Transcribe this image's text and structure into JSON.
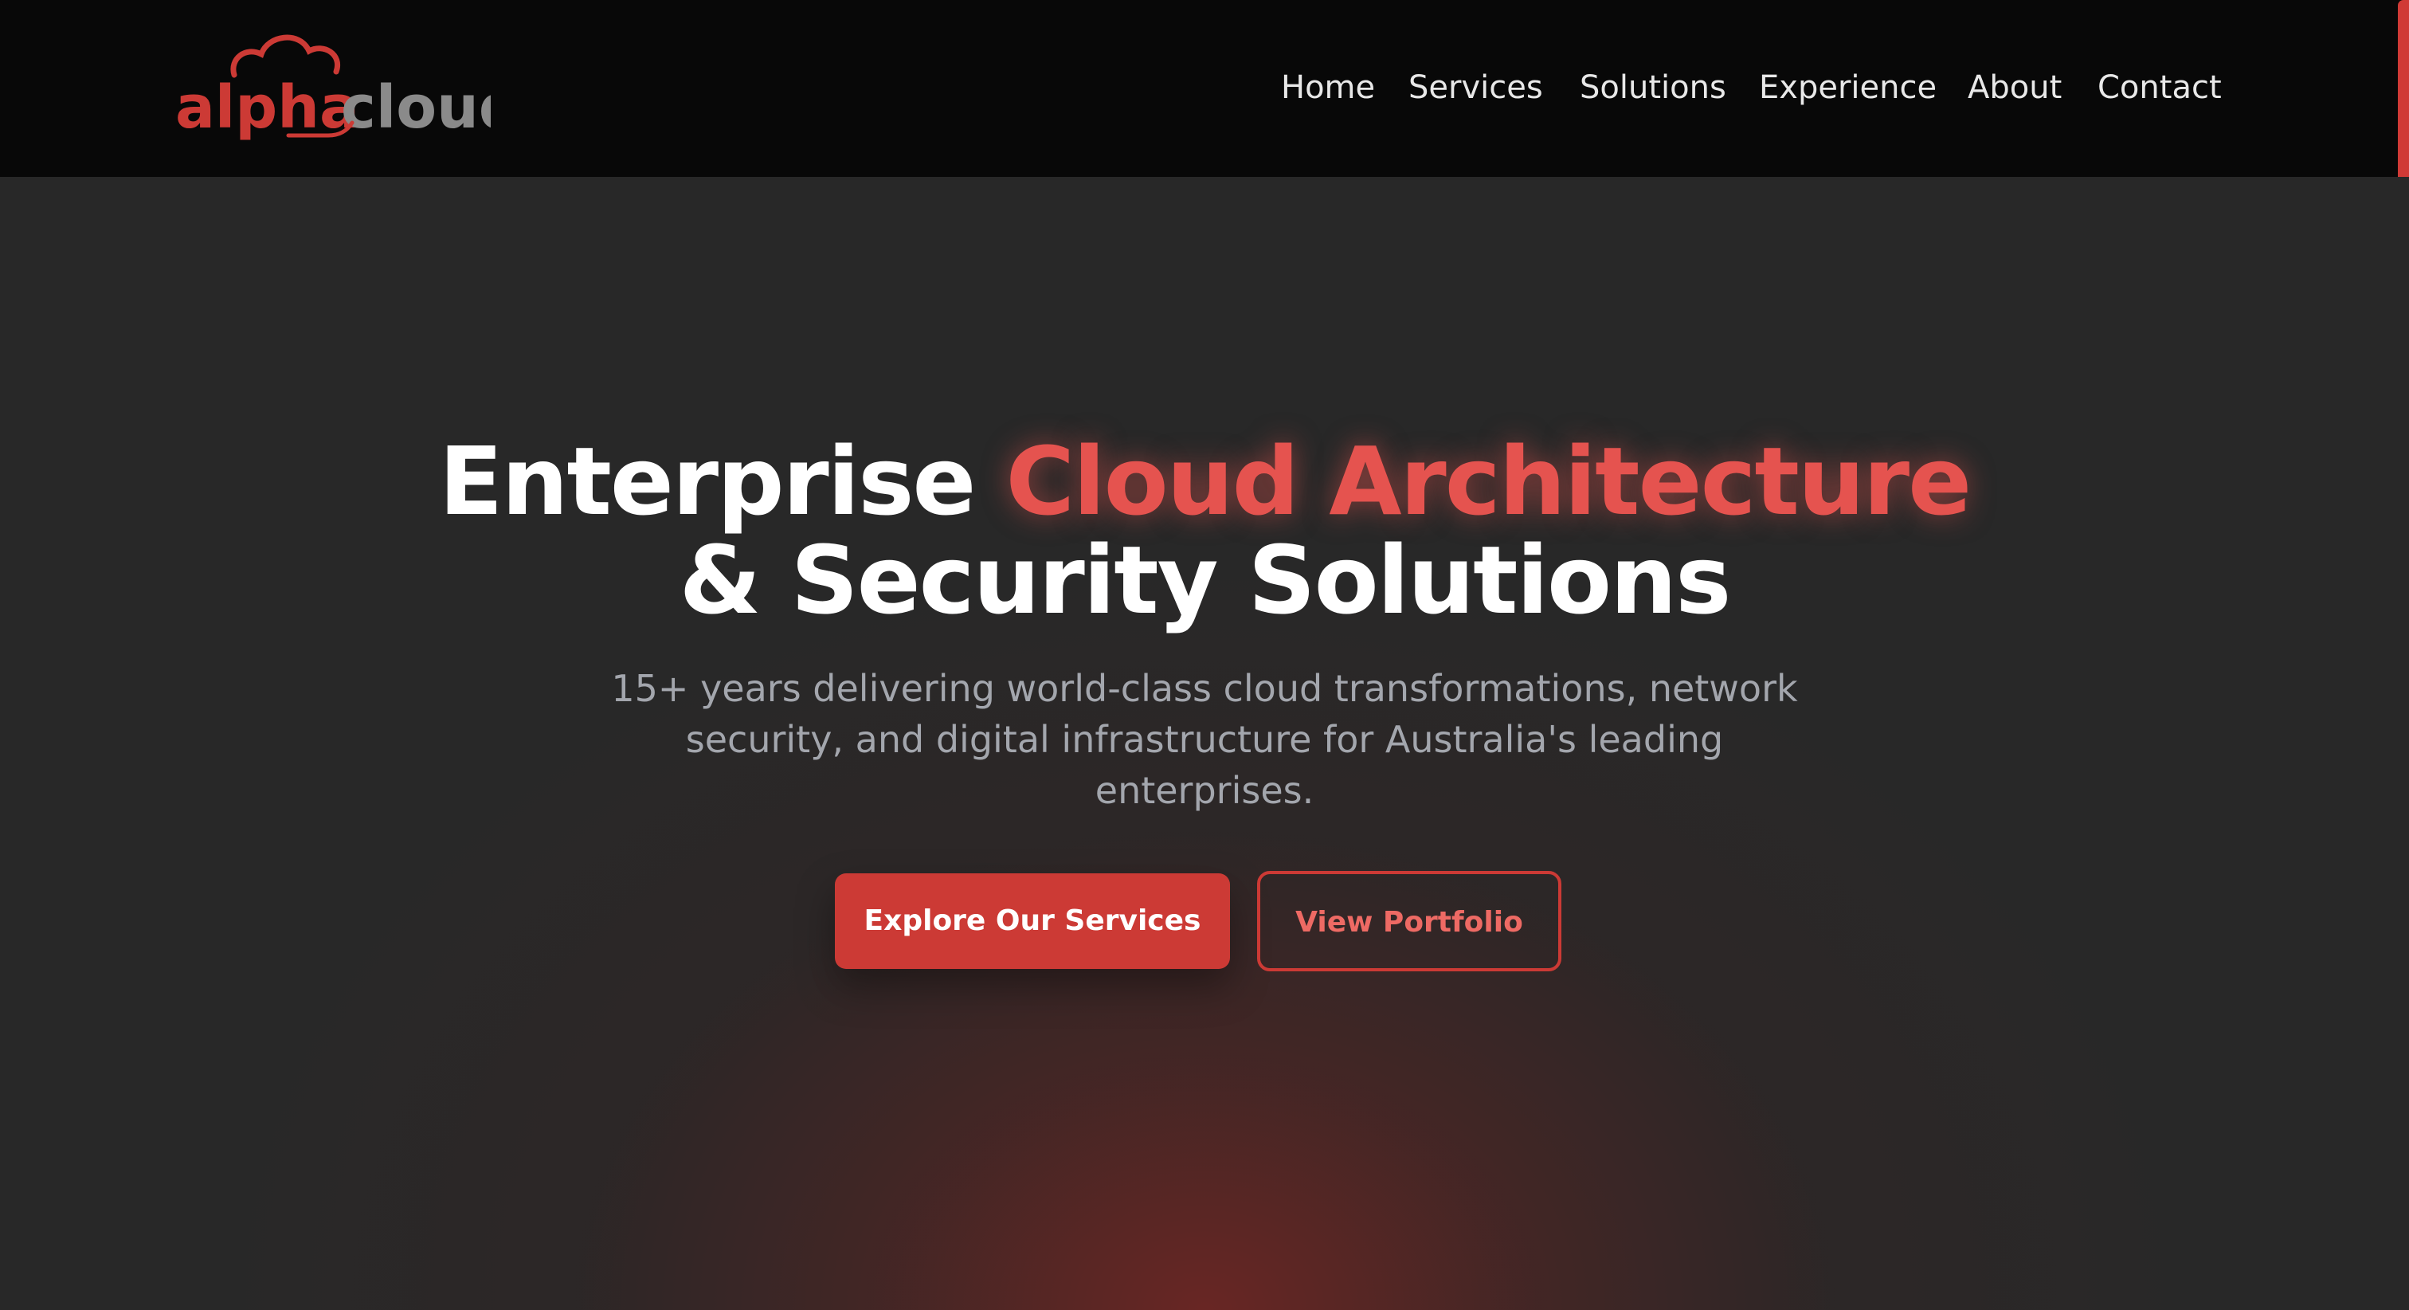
{
  "brand": {
    "name_part1": "alpha",
    "name_part2": "cloud",
    "primary_color": "#cc3a35",
    "secondary_color": "#8a8a8a",
    "logo_icon": "cloud-icon"
  },
  "nav": {
    "items": [
      {
        "label": "Home"
      },
      {
        "label": "Services"
      },
      {
        "label": "Solutions"
      },
      {
        "label": "Experience"
      },
      {
        "label": "About"
      },
      {
        "label": "Contact"
      }
    ]
  },
  "hero": {
    "headline_part1": "Enterprise ",
    "headline_accent": "Cloud Architecture",
    "headline_part2": "& Security Solutions",
    "subtitle": "15+ years delivering world-class cloud transformations, network security, and digital infrastructure for Australia's leading enterprises.",
    "primary_button": "Explore Our Services",
    "secondary_button": "View Portfolio"
  },
  "colors": {
    "header_bg": "#080808",
    "page_bg": "#282828",
    "accent": "#e5534f",
    "button": "#cc3a35",
    "text": "#ffffff",
    "muted_text": "#a3a6ad"
  }
}
